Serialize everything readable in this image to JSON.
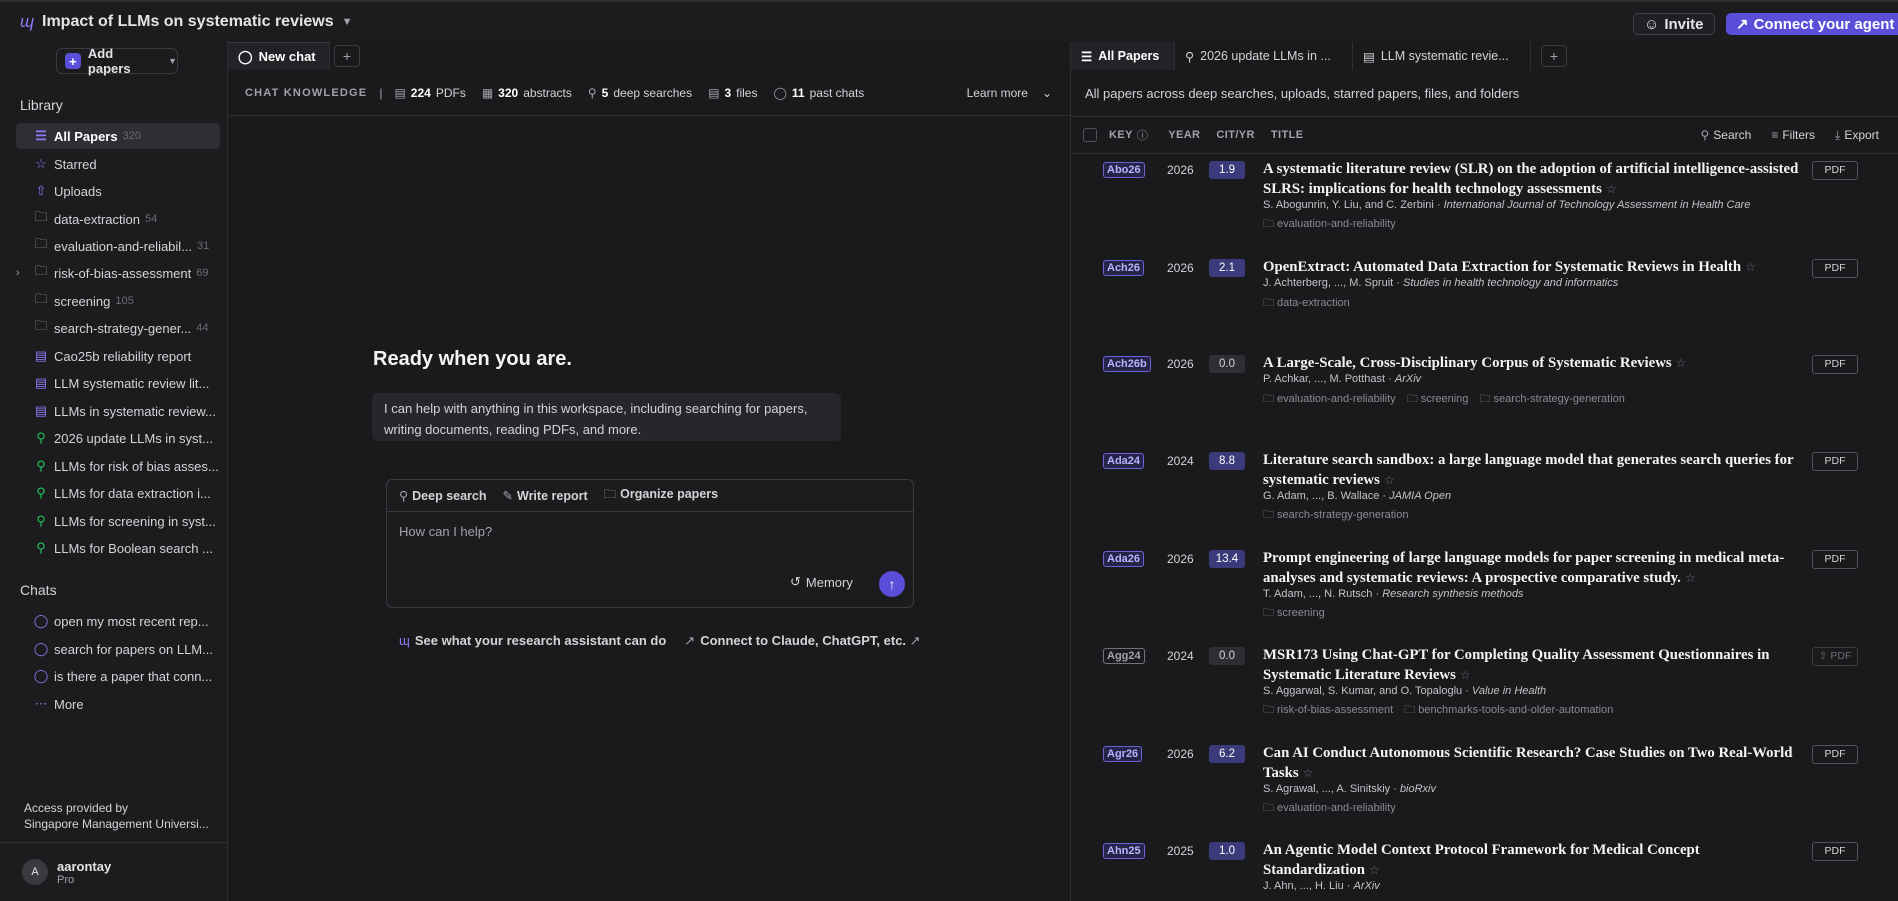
{
  "workspace": {
    "logo": "ɰ",
    "title": "Impact of LLMs on systematic reviews"
  },
  "topbar": {
    "invite_label": "Invite",
    "connect_label": "Connect your agent"
  },
  "sidebar": {
    "add_papers_label": "Add papers",
    "library_label": "Library",
    "library_items": [
      {
        "label": "All Papers",
        "count": "320",
        "icon": "library-icon"
      },
      {
        "label": "Starred",
        "count": "",
        "icon": "star-icon"
      },
      {
        "label": "Uploads",
        "count": "",
        "icon": "upload-icon"
      },
      {
        "label": "data-extraction",
        "count": "54",
        "icon": "folder-icon"
      },
      {
        "label": "evaluation-and-reliabil...",
        "count": "31",
        "icon": "folder-icon"
      },
      {
        "label": "risk-of-bias-assessment",
        "count": "69",
        "icon": "folder-icon"
      },
      {
        "label": "screening",
        "count": "105",
        "icon": "folder-icon"
      },
      {
        "label": "search-strategy-gener...",
        "count": "44",
        "icon": "folder-icon"
      },
      {
        "label": "Cao25b reliability report",
        "count": "",
        "icon": "document-icon"
      },
      {
        "label": "LLM systematic review lit...",
        "count": "",
        "icon": "document-icon"
      },
      {
        "label": "LLMs in systematic review...",
        "count": "",
        "icon": "document-icon"
      },
      {
        "label": "2026 update LLMs in syst...",
        "count": "",
        "icon": "deep-search-icon"
      },
      {
        "label": "LLMs for risk of bias asses...",
        "count": "",
        "icon": "deep-search-icon"
      },
      {
        "label": "LLMs for data extraction i...",
        "count": "",
        "icon": "deep-search-icon"
      },
      {
        "label": "LLMs for screening in syst...",
        "count": "",
        "icon": "deep-search-icon"
      },
      {
        "label": "LLMs for Boolean search ...",
        "count": "",
        "icon": "deep-search-icon"
      }
    ],
    "chats_label": "Chats",
    "chat_items": [
      {
        "label": "open my most recent rep..."
      },
      {
        "label": "search for papers on LLM..."
      },
      {
        "label": "is there a paper that conn..."
      }
    ],
    "more_label": "More",
    "access_line1": "Access provided by",
    "access_line2": "Singapore Management Universi...",
    "user": {
      "initial": "A",
      "name": "aarontay",
      "plan": "Pro"
    }
  },
  "chat": {
    "tab_label": "New chat",
    "knowledge_label": "CHAT KNOWLEDGE",
    "stats": [
      {
        "n": "224",
        "label": "PDFs"
      },
      {
        "n": "320",
        "label": "abstracts"
      },
      {
        "n": "5",
        "label": "deep searches"
      },
      {
        "n": "3",
        "label": "files"
      },
      {
        "n": "11",
        "label": "past chats"
      }
    ],
    "learn_more": "Learn more",
    "ready_title": "Ready when you are.",
    "help_text": "I can help with anything in this workspace, including searching for papers, writing documents, reading PDFs, and more.",
    "actions": [
      "Deep search",
      "Write report",
      "Organize papers"
    ],
    "input_placeholder": "How can I help?",
    "memory_label": "Memory",
    "link_1": "See what your research assistant can do",
    "link_2": "Connect to Claude, ChatGPT, etc."
  },
  "papers": {
    "tabs": [
      "All Papers",
      "2026 update LLMs in ...",
      "LLM systematic revie..."
    ],
    "description": "All papers across deep searches, uploads, starred papers, files, and folders",
    "columns": {
      "key": "KEY",
      "year": "YEAR",
      "cit": "CIT/YR",
      "title": "TITLE"
    },
    "tools": {
      "search": "Search",
      "filters": "Filters",
      "export": "Export"
    },
    "rows": [
      {
        "key": "Abo26",
        "year": "2026",
        "cit": "1.9",
        "title": "A systematic literature review (SLR) on the adoption of artificial intelligence-assisted SLRS: implications for health technology assessments",
        "authors": "S. Abogunrin, Y. Liu, and C. Zerbini · ",
        "venue": "International Journal of Technology Assessment in Health Care",
        "tags": [
          "evaluation-and-reliability"
        ],
        "pdf": "PDF",
        "pdf_available": true
      },
      {
        "key": "Ach26",
        "year": "2026",
        "cit": "2.1",
        "title": "OpenExtract: Automated Data Extraction for Systematic Reviews in Health",
        "authors": "J. Achterberg, ..., M. Spruit · ",
        "venue": "Studies in health technology and informatics",
        "tags": [
          "data-extraction"
        ],
        "pdf": "PDF",
        "pdf_available": true
      },
      {
        "key": "Ach26b",
        "year": "2026",
        "cit": "0.0",
        "title": "A Large-Scale, Cross-Disciplinary Corpus of Systematic Reviews",
        "authors": "P. Achkar, ..., M. Potthast · ",
        "venue": "ArXiv",
        "tags": [
          "evaluation-and-reliability",
          "screening",
          "search-strategy-generation"
        ],
        "pdf": "PDF",
        "pdf_available": true
      },
      {
        "key": "Ada24",
        "year": "2024",
        "cit": "8.8",
        "title": "Literature search sandbox: a large language model that generates search queries for systematic reviews",
        "authors": "G. Adam, ..., B. Wallace · ",
        "venue": "JAMIA Open",
        "tags": [
          "search-strategy-generation"
        ],
        "pdf": "PDF",
        "pdf_available": true
      },
      {
        "key": "Ada26",
        "year": "2026",
        "cit": "13.4",
        "title": "Prompt engineering of large language models for paper screening in medical meta-analyses and systematic reviews: A prospective comparative study.",
        "authors": "T. Adam, ..., N. Rutsch · ",
        "venue": "Research synthesis methods",
        "tags": [
          "screening"
        ],
        "pdf": "PDF",
        "pdf_available": true
      },
      {
        "key": "Agg24",
        "year": "2024",
        "cit": "0.0",
        "title": "MSR173 Using Chat-GPT for Completing Quality Assessment Questionnaires in Systematic Literature Reviews",
        "authors": "S. Aggarwal, S. Kumar, and O. Topaloglu · ",
        "venue": "Value in Health",
        "tags": [
          "risk-of-bias-assessment",
          "benchmarks-tools-and-older-automation"
        ],
        "pdf": "PDF",
        "pdf_available": false
      },
      {
        "key": "Agr26",
        "year": "2026",
        "cit": "6.2",
        "title": "Can AI Conduct Autonomous Scientific Research? Case Studies on Two Real-World Tasks",
        "authors": "S. Agrawal, ..., A. Sinitskiy · ",
        "venue": "bioRxiv",
        "tags": [
          "evaluation-and-reliability"
        ],
        "pdf": "PDF",
        "pdf_available": true
      },
      {
        "key": "Ahn25",
        "year": "2025",
        "cit": "1.0",
        "title": "An Agentic Model Context Protocol Framework for Medical Concept Standardization",
        "authors": "J. Ahn, ..., H. Liu · ",
        "venue": "ArXiv",
        "tags": [],
        "pdf": "PDF",
        "pdf_available": true
      }
    ]
  }
}
